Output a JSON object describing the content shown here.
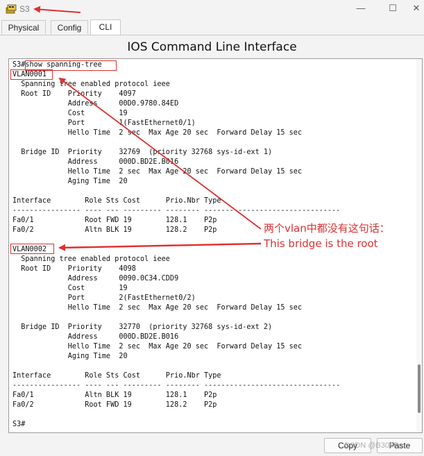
{
  "window": {
    "title": "S3",
    "controls": {
      "minimize": "—",
      "maximize": "☐",
      "close": "✕"
    }
  },
  "tabs": [
    {
      "label": "Physical",
      "active": false
    },
    {
      "label": "Config",
      "active": false
    },
    {
      "label": "CLI",
      "active": true
    }
  ],
  "pane_title": "IOS Command Line Interface",
  "console": {
    "lines": [
      "S3#show spanning-tree",
      "VLAN0001",
      "  Spanning tree enabled protocol ieee",
      "  Root ID    Priority    4097",
      "             Address     00D0.9780.84ED",
      "             Cost        19",
      "             Port        1(FastEthernet0/1)",
      "             Hello Time  2 sec  Max Age 20 sec  Forward Delay 15 sec",
      "",
      "  Bridge ID  Priority    32769  (priority 32768 sys-id-ext 1)",
      "             Address     000D.BD2E.B016",
      "             Hello Time  2 sec  Max Age 20 sec  Forward Delay 15 sec",
      "             Aging Time  20",
      "",
      "Interface        Role Sts Cost      Prio.Nbr Type",
      "---------------- ---- --- --------- -------- --------------------------------",
      "Fa0/1            Root FWD 19        128.1    P2p",
      "Fa0/2            Altn BLK 19        128.2    P2p",
      "",
      "VLAN0002",
      "  Spanning tree enabled protocol ieee",
      "  Root ID    Priority    4098",
      "             Address     0090.0C34.CDD9",
      "             Cost        19",
      "             Port        2(FastEthernet0/2)",
      "             Hello Time  2 sec  Max Age 20 sec  Forward Delay 15 sec",
      "",
      "  Bridge ID  Priority    32770  (priority 32768 sys-id-ext 2)",
      "             Address     000D.BD2E.B016",
      "             Hello Time  2 sec  Max Age 20 sec  Forward Delay 15 sec",
      "             Aging Time  20",
      "",
      "Interface        Role Sts Cost      Prio.Nbr Type",
      "---------------- ---- --- --------- -------- --------------------------------",
      "Fa0/1            Altn BLK 19        128.1    P2p",
      "Fa0/2            Root FWD 19        128.2    P2p",
      "",
      "S3#"
    ]
  },
  "annotation": {
    "line1": "两个vlan中都没有这句话：",
    "line2": "This bridge is the root",
    "color": "#e03030"
  },
  "buttons": {
    "copy": "Copy",
    "paste": "Paste"
  },
  "watermark": "CSDN @B306Pa"
}
